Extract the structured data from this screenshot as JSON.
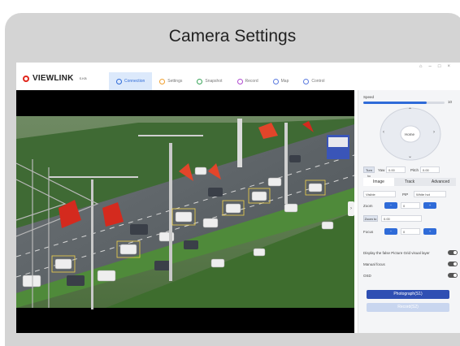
{
  "card": {
    "title": "Camera Settings"
  },
  "brand": {
    "name": "VIEWLINK",
    "sub": "S.KB"
  },
  "nav": [
    {
      "label": "Connection",
      "icon": "link-icon"
    },
    {
      "label": "Settings",
      "icon": "gear-icon"
    },
    {
      "label": "Snapshot",
      "icon": "camera-icon"
    },
    {
      "label": "Record",
      "icon": "record-icon"
    },
    {
      "label": "Map",
      "icon": "map-icon"
    },
    {
      "label": "Control",
      "icon": "control-icon"
    }
  ],
  "window_controls": [
    "⌂",
    "–",
    "□",
    "×"
  ],
  "panel": {
    "speed_label": "Speed",
    "speed_value": "10",
    "speed_fraction": 0.78,
    "ptz_center": "Home",
    "turn_to": "Turn to",
    "yaw_label": "Yaw",
    "yaw_value": "0.00",
    "pitch_label": "Pitch",
    "pitch_value": "0.00",
    "subtabs": [
      "Image",
      "Track",
      "Advanced"
    ],
    "mode_select": "Visible",
    "pip_label": "PIP",
    "white_hot": "White hot",
    "zoom_label": "Zoom",
    "zoom_value": "0",
    "zoom_to_label": "Zoom to",
    "zoom_to_value": "0.00",
    "focus_label": "Focus",
    "focus_value": "0",
    "toggle1": "Display the false Picture Grid visual layer",
    "toggle2": "Manual focus",
    "toggle3": "OSD",
    "photo_btn": "Photograph(S1)",
    "record_btn": "Record(S2)"
  }
}
